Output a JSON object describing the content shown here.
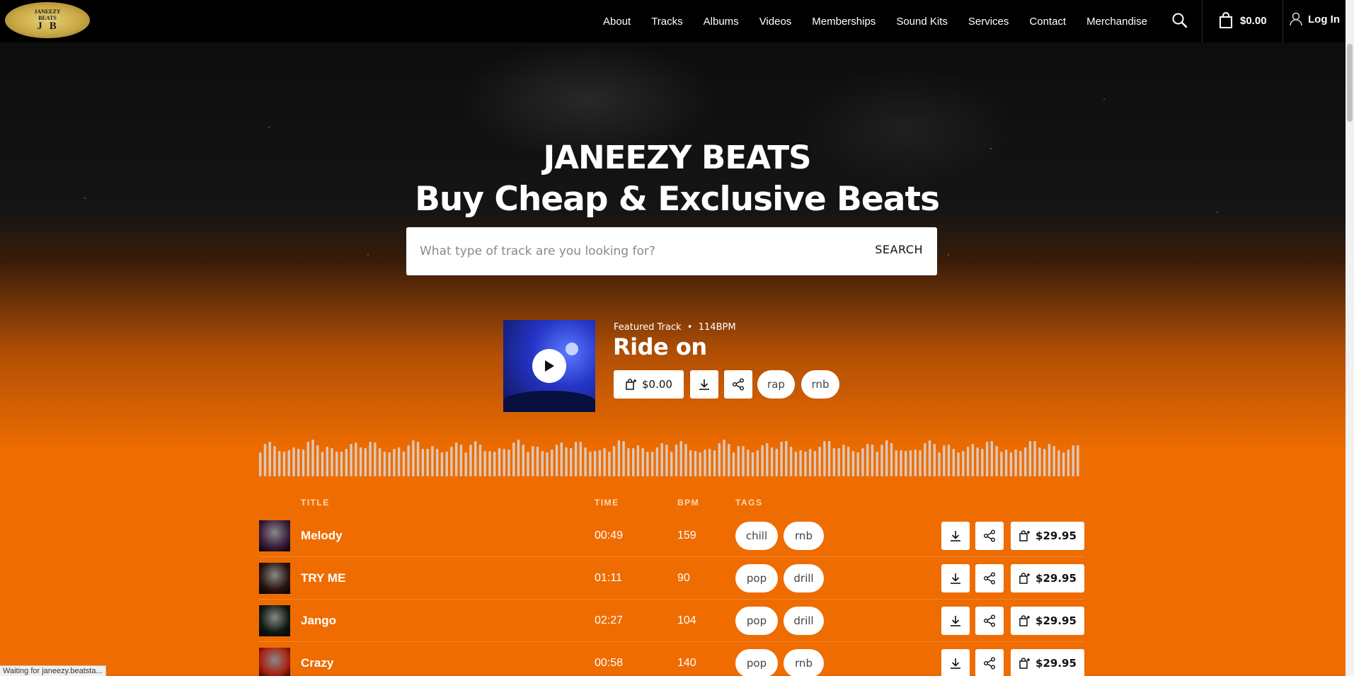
{
  "logo": {
    "line1": "JANEEZY",
    "line2": "BEATS",
    "line3": "JB"
  },
  "nav": {
    "items": [
      "About",
      "Tracks",
      "Albums",
      "Videos",
      "Memberships",
      "Sound Kits",
      "Services",
      "Contact",
      "Merchandise"
    ],
    "cart_total": "$0.00",
    "login_label": "Log In"
  },
  "hero": {
    "title": "JANEEZY BEATS",
    "subtitle": "Buy Cheap & Exclusive Beats",
    "search_placeholder": "What type of track are you looking for?",
    "search_button": "SEARCH"
  },
  "featured": {
    "label": "Featured Track",
    "bpm": "114BPM",
    "title": "Ride on",
    "price": "$0.00",
    "tags": [
      "rap",
      "rnb"
    ]
  },
  "table": {
    "headers": {
      "title": "TITLE",
      "time": "TIME",
      "bpm": "BPM",
      "tags": "TAGS"
    },
    "rows": [
      {
        "title": "Melody",
        "time": "00:49",
        "bpm": "159",
        "tags": [
          "chill",
          "rnb"
        ],
        "price": "$29.95",
        "thumb_color": "#3a1c3c"
      },
      {
        "title": "TRY ME",
        "time": "01:11",
        "bpm": "90",
        "tags": [
          "pop",
          "drill"
        ],
        "price": "$29.95",
        "thumb_color": "#2a1410"
      },
      {
        "title": "Jango",
        "time": "02:27",
        "bpm": "104",
        "tags": [
          "pop",
          "drill"
        ],
        "price": "$29.95",
        "thumb_color": "#0f1a10"
      },
      {
        "title": "Crazy",
        "time": "00:58",
        "bpm": "140",
        "tags": [
          "pop",
          "rnb"
        ],
        "price": "$29.95",
        "thumb_color": "#a82010"
      }
    ]
  },
  "status_bar": "Waiting for janeezy.beatsta...",
  "colors": {
    "accent_orange": "#ee6c00",
    "header_bg": "#000000"
  }
}
